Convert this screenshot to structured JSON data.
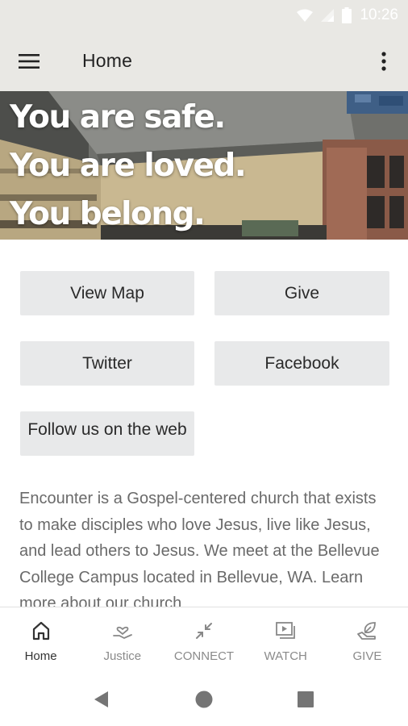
{
  "status_bar": {
    "time": "10:26",
    "icons": [
      "wifi-icon",
      "signal-icon",
      "battery-icon"
    ]
  },
  "app_bar": {
    "title": "Home",
    "menu_icon": "hamburger-menu-icon",
    "overflow_icon": "more-vert-icon"
  },
  "hero": {
    "lines": [
      "You are safe.",
      "You are loved.",
      "You belong."
    ]
  },
  "buttons": {
    "view_map": "View Map",
    "give": "Give",
    "twitter": "Twitter",
    "facebook": "Facebook",
    "follow_web": "Follow us on the web"
  },
  "description": "Encounter is a Gospel-centered church that exists to make disciples who love Jesus, live like Jesus, and lead others to Jesus. We meet at the Bellevue College Campus located in Bellevue, WA. Learn more about our church",
  "bottom_nav": {
    "items": [
      {
        "label": "Home",
        "icon": "home-icon",
        "active": true
      },
      {
        "label": "Justice",
        "icon": "hand-heart-icon",
        "active": false
      },
      {
        "label": "CONNECT",
        "icon": "connect-arrows-icon",
        "active": false
      },
      {
        "label": "WATCH",
        "icon": "video-play-icon",
        "active": false
      },
      {
        "label": "GIVE",
        "icon": "leaf-hand-icon",
        "active": false
      }
    ]
  },
  "system_nav": {
    "icons": [
      "back-triangle-icon",
      "home-circle-icon",
      "recents-square-icon"
    ]
  },
  "colors": {
    "app_bar_bg": "#e9e8e4",
    "button_bg": "#e8e9ea",
    "description_text": "#6a6a6a",
    "hero_text": "#ffffff"
  }
}
